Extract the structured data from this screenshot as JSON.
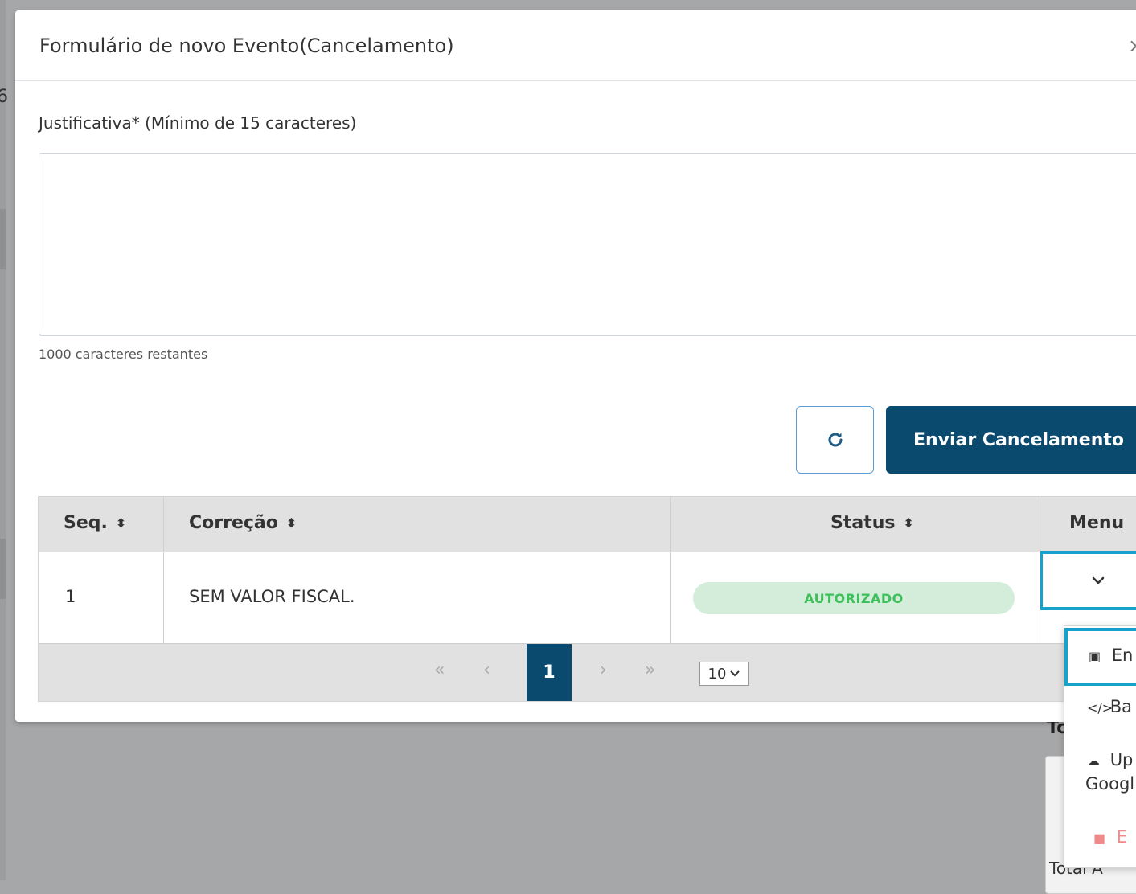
{
  "modal": {
    "title": "Formulário de novo Evento(Cancelamento)",
    "close_symbol": "×"
  },
  "form": {
    "justification_label": "Justificativa* (Mínimo de 15 caracteres)",
    "justification_value": "",
    "remaining_counter": "1000 caracteres restantes",
    "send_button_label": "Enviar Cancelamento",
    "refresh_icon": "refresh-icon"
  },
  "table": {
    "headers": {
      "seq": "Seq.",
      "correcao": "Correção",
      "status": "Status",
      "menu": "Menu"
    },
    "rows": [
      {
        "seq": "1",
        "correcao": "SEM VALOR FISCAL.",
        "status": "AUTORIZADO"
      }
    ],
    "pagination": {
      "first": "«",
      "prev": "‹",
      "current_page": "1",
      "next": "›",
      "last": "»",
      "page_size": "10"
    }
  },
  "dropdown_menu": {
    "items": [
      {
        "icon": "pdf-icon",
        "label": "En"
      },
      {
        "icon": "code-icon",
        "label": "Ba"
      },
      {
        "icon": "cloud-upload-icon",
        "label_line1": "Up",
        "label_line2": "Googl"
      },
      {
        "icon": "trash-icon",
        "label": "E"
      }
    ]
  },
  "background": {
    "partial_char": "6",
    "total_heading_fragment": "To",
    "total_label_fragment": "Total A"
  },
  "colors": {
    "primary": "#0b4a6f",
    "highlight": "#17a2c9",
    "success_bg": "#d4edda",
    "success_text": "#3fbf5a",
    "danger": "#f08a8a"
  }
}
